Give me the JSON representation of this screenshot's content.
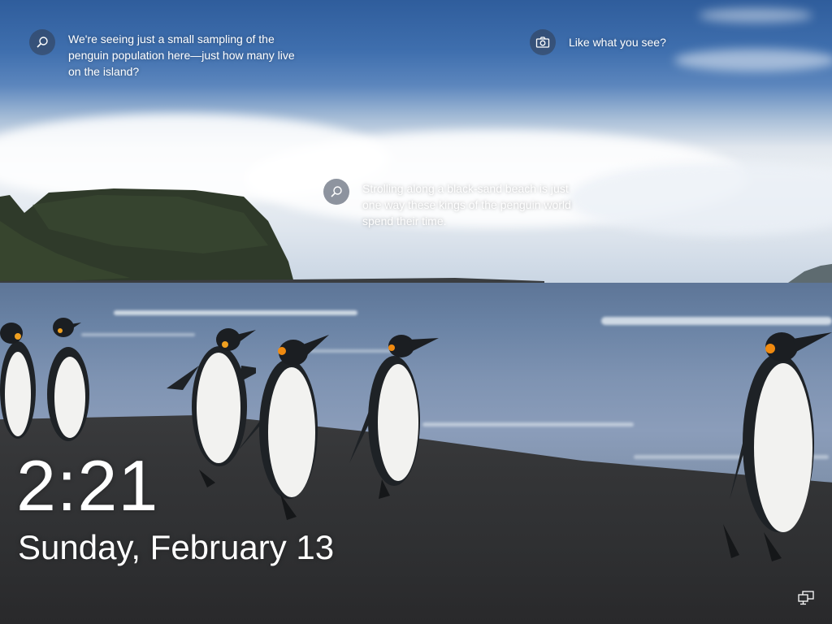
{
  "lockscreen": {
    "hotspots": [
      {
        "icon": "search-icon",
        "text": "We're seeing just a small sampling of the penguin population here—just how many live on the island?"
      },
      {
        "icon": "camera-icon",
        "text": "Like what you see?"
      },
      {
        "icon": "search-icon",
        "text": "Strolling along a black-sand beach is just one way these kings of the penguin world spend their time."
      }
    ],
    "time": "2:21",
    "date": "Sunday, February 13",
    "status_icons": [
      "network-icon"
    ]
  }
}
